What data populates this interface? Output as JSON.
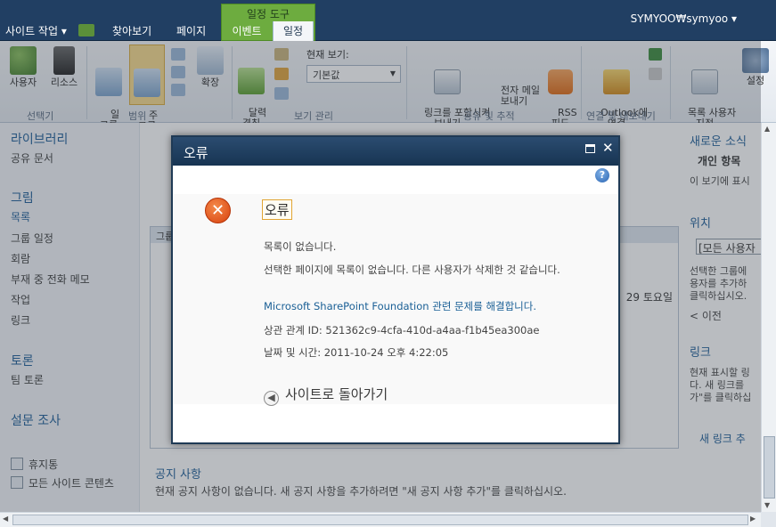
{
  "topbar": {
    "site_actions": "사이트 작업 ▾",
    "tabs": [
      "찾아보기",
      "페이지"
    ],
    "contextual_group": "일정 도구",
    "tab_events": "이벤트",
    "tab_calendar": "일정",
    "user": "SYMYOO₩symyoo ▾"
  },
  "ribbon": {
    "buttons": {
      "user": "사용자",
      "resource": "리소스",
      "day_group": "일\n그룹",
      "week_group": "주\n그룹",
      "expand": "확장",
      "calendar_overlay": "달력\n겹침",
      "email_link": "링크를 포함시켜\n보내기",
      "email_alert": "전자 메일\n보내기",
      "rss": "RSS\n피드",
      "outlook": "Outlook에\n연결",
      "custom_list": "목록 사용자\n지정",
      "settings": "설정"
    },
    "current_view_label": "현재 보기:",
    "current_view_value": "기본값",
    "groups": [
      "선택기",
      "범위",
      "보기 관리",
      "공유 및 추적",
      "연결 및 내보내기"
    ]
  },
  "leftnav": {
    "library": "라이브러리",
    "shared_docs": "공유 문서",
    "lists": "그림",
    "list_items": [
      "목록",
      "그룹 일정",
      "회람",
      "부재 중 전화 메모",
      "작업",
      "링크"
    ],
    "discussion": "토론",
    "team_discussion": "팀 토론",
    "survey": "설문 조사",
    "recycle": "휴지통",
    "all_content": "모든 사이트 콘텐츠"
  },
  "content": {
    "frame_header": "그룹",
    "date_fragment": "29 토요일",
    "notice_title": "공지 사항",
    "notice_text": "현재 공지 사항이 없습니다. 새 공지 사항을 추가하려면 \"새 공지 사항 추가\"를 클릭하십시오."
  },
  "rightpanel": {
    "news": "새로운 소식",
    "personal": "개인 항목",
    "view_msg": "이 보기에 표시",
    "location": "위치",
    "location_box": "[모든 사용자",
    "group_msg": [
      "선택한 그룹에",
      "용자를 추가하",
      "클릭하십시오."
    ],
    "prev": "< 이전",
    "links": "링크",
    "links_msg": [
      "현재 표시할 링",
      "다. 새 링크를",
      "가\"를 클릭하십"
    ],
    "new_link": "새 링크 추"
  },
  "dialog": {
    "title": "오류",
    "heading": "오류",
    "line1": "목록이 없습니다.",
    "line2": "선택한 페이지에 목록이 없습니다. 다른 사용자가 삭제한 것 같습니다.",
    "troubleshoot": "Microsoft SharePoint Foundation 관련 문제를 해결합니다.",
    "correlation": "상관 관계 ID: 521362c9-4cfa-410d-a4aa-f1b45ea300ae",
    "datetime": "날짜 및 시간: 2011-10-24 오후 4:22:05",
    "back": "사이트로 돌아가기"
  },
  "colors": {
    "topbar": "#213f63",
    "contextual": "#6dac3f",
    "link": "#1b5c96",
    "error": "#d8410e"
  }
}
